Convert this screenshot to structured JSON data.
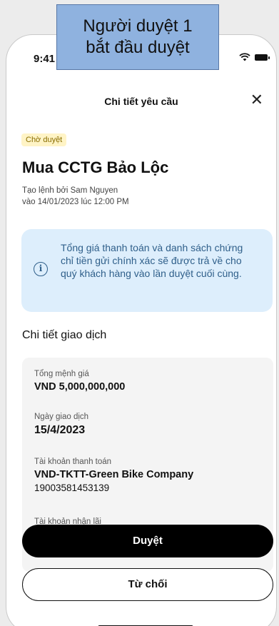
{
  "status_bar": {
    "time": "9:41"
  },
  "annotation": {
    "line1": "Người duyệt 1",
    "line2": "bắt đầu duyệt"
  },
  "header": {
    "title": "Chi tiết yêu cầu",
    "close_symbol": "✕"
  },
  "request": {
    "status_badge": "Chờ duyệt",
    "title": "Mua CCTG Bảo Lộc",
    "created_by": "Tạo lệnh bởi Sam Nguyen",
    "created_at": "vào 14/01/2023 lúc 12:00 PM"
  },
  "info_notice": {
    "icon": "info-icon",
    "text": "Tổng giá thanh toán và danh sách chứng chỉ tiền gửi chính xác sẽ được trả về cho quý khách hàng vào lần duyệt cuối cùng."
  },
  "transaction": {
    "section_title": "Chi tiết giao dịch",
    "fields": [
      {
        "label": "Tổng mệnh giá",
        "value": "VND 5,000,000,000"
      },
      {
        "label": "Ngày giao dịch",
        "value": "15/4/2023"
      },
      {
        "label": "Tài khoản thanh toán",
        "value": "VND-TKTT-Green Bike Company",
        "sub": "19003581453139"
      },
      {
        "label": "Tài khoản nhận lãi"
      }
    ]
  },
  "actions": {
    "approve_label": "Duyệt",
    "reject_label": "Từ chối"
  },
  "colors": {
    "info_bg": "#ddeefc",
    "info_text": "#2f5f8a",
    "badge_bg": "#fff4c6",
    "callout_bg": "#8fb2df"
  }
}
